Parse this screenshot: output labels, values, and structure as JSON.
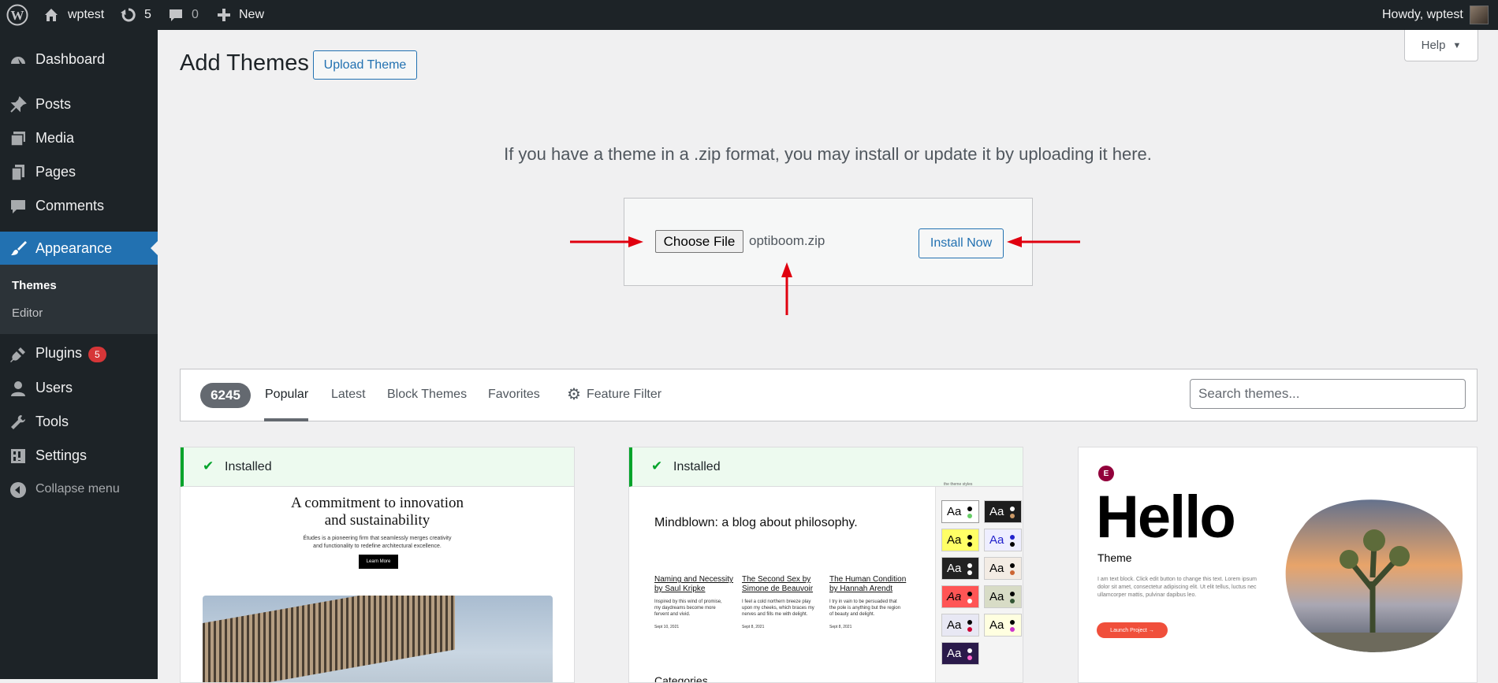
{
  "admin_bar": {
    "site_name": "wptest",
    "updates_count": "5",
    "comments_count": "0",
    "new_label": "New",
    "howdy": "Howdy, wptest"
  },
  "sidebar": {
    "items": [
      {
        "label": "Dashboard",
        "icon": "dashboard-icon"
      },
      {
        "label": "Posts",
        "icon": "pin-icon"
      },
      {
        "label": "Media",
        "icon": "media-icon"
      },
      {
        "label": "Pages",
        "icon": "pages-icon"
      },
      {
        "label": "Comments",
        "icon": "comment-icon"
      },
      {
        "label": "Appearance",
        "icon": "brush-icon"
      },
      {
        "label": "Plugins",
        "icon": "plug-icon",
        "badge": "5"
      },
      {
        "label": "Users",
        "icon": "user-icon"
      },
      {
        "label": "Tools",
        "icon": "wrench-icon"
      },
      {
        "label": "Settings",
        "icon": "sliders-icon"
      },
      {
        "label": "Collapse menu",
        "icon": "collapse-icon"
      }
    ],
    "submenu": [
      "Themes",
      "Editor"
    ]
  },
  "header": {
    "title": "Add Themes",
    "upload_button": "Upload Theme",
    "help": "Help"
  },
  "upload": {
    "description": "If you have a theme in a .zip format, you may install or update it by uploading it here.",
    "choose_file": "Choose File",
    "file_name": "optiboom.zip",
    "install_button": "Install Now"
  },
  "filter": {
    "count": "6245",
    "tabs": [
      "Popular",
      "Latest",
      "Block Themes",
      "Favorites"
    ],
    "feature_filter": "Feature Filter",
    "search_placeholder": "Search themes..."
  },
  "themes": {
    "installed_label": "Installed",
    "card1": {
      "headline_1": "A commitment to innovation",
      "headline_2": "and sustainability",
      "body_1": "Études is a pioneering firm that seamlessly merges creativity",
      "body_2": "and functionality to redefine architectural excellence.",
      "button": "Learn More"
    },
    "card2": {
      "heading": "Mindblown: a blog about philosophy.",
      "top_label": "the theme styles",
      "posts": [
        {
          "title_1": "Naming and Necessity",
          "title_2": "by Saul Kripke",
          "excerpt_1": "Inspired by this wind of promise,",
          "excerpt_2": "my daydreams become more",
          "excerpt_3": "fervent and vivid.",
          "date": "Sept 10, 2021"
        },
        {
          "title_1": "The Second Sex by",
          "title_2": "Simone de Beauvoir",
          "excerpt_1": "I feel a cold northern breeze play",
          "excerpt_2": "upon my cheeks, which braces my",
          "excerpt_3": "nerves and fills me with delight.",
          "date": "Sept 8, 2021"
        },
        {
          "title_1": "The Human Condition",
          "title_2": "by Hannah Arendt",
          "excerpt_1": "I try in vain to be persuaded that",
          "excerpt_2": "the pole is anything but the region",
          "excerpt_3": "of beauty and delight.",
          "date": "Sept 8, 2021"
        }
      ],
      "style_sample": "Aa",
      "bottom_text": "Categories"
    },
    "card3": {
      "title": "Hello",
      "subtitle": "Theme",
      "body_1": "I am text block. Click edit button to change this text. Lorem ipsum",
      "body_2": "dolor sit amet, consectetur adipiscing elit. Ut elit tellus, luctus nec",
      "body_3": "ullamcorper mattis, pulvinar dapibus leo.",
      "button": "Launch Project  →"
    }
  },
  "colors": {
    "admin_dark": "#1d2327",
    "accent": "#2271b1",
    "annotation_arrow": "#e0000f",
    "installed_green": "#00a32a"
  }
}
